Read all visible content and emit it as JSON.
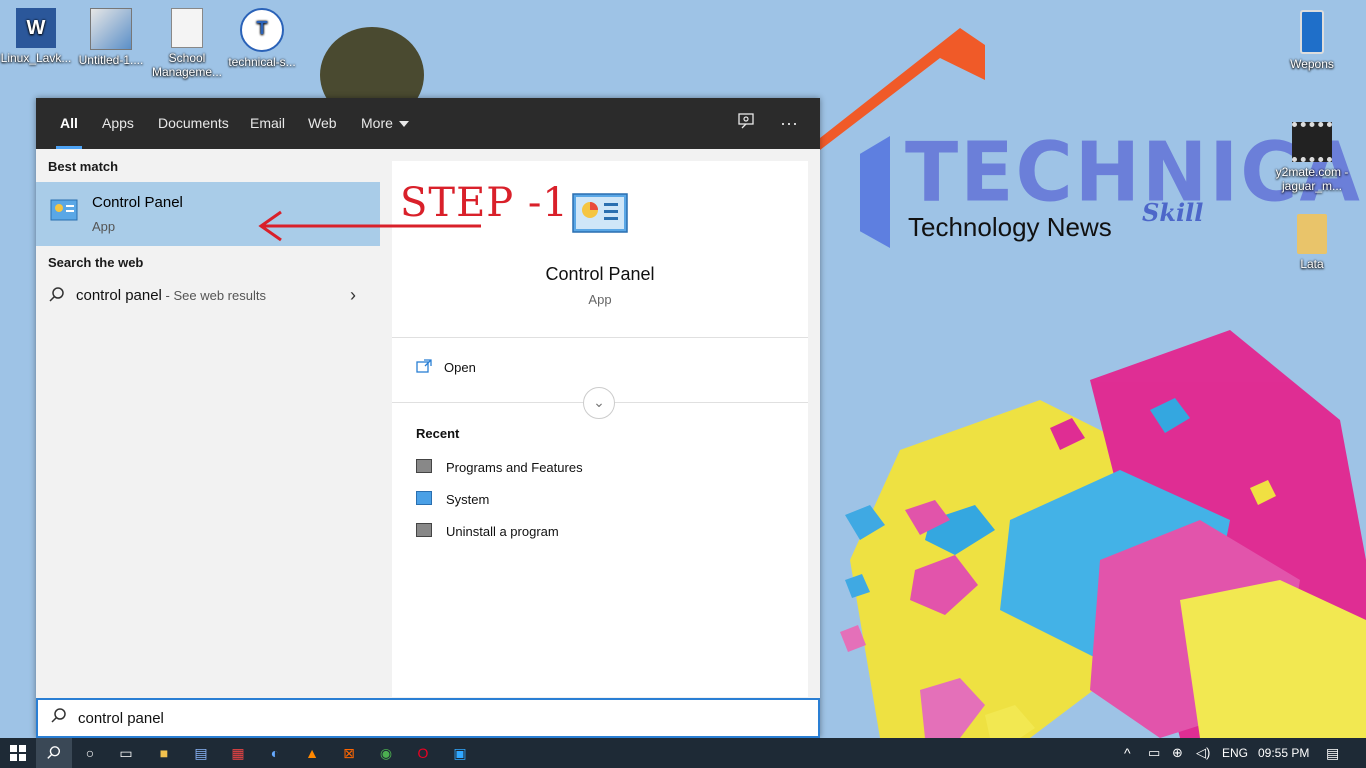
{
  "desktop": {
    "brand": {
      "title": "TECHNICAL",
      "skill": "Skill",
      "news": "Technology News"
    },
    "icons_left": [
      {
        "label": "Linux_Lavk...",
        "icon": "word-doc-icon"
      },
      {
        "label": "Untitled-1....",
        "icon": "image-icon"
      },
      {
        "label": "School Manageme...",
        "icon": "document-icon"
      },
      {
        "label": "technical-s...",
        "icon": "logo-icon"
      }
    ],
    "icons_right": [
      {
        "label": "Wepons",
        "icon": "phone-shortcut-icon"
      },
      {
        "label": "y2mate.com - jaguar_m...",
        "icon": "video-file-icon"
      },
      {
        "label": "Lata",
        "icon": "folder-icon"
      }
    ]
  },
  "search_panel": {
    "tabs": [
      "All",
      "Apps",
      "Documents",
      "Email",
      "Web",
      "More"
    ],
    "active_tab": "All",
    "best_match_heading": "Best match",
    "best_match": {
      "name": "Control Panel",
      "kind": "App"
    },
    "web_heading": "Search the web",
    "web_result": {
      "query": "control panel",
      "suffix": " - See web results"
    },
    "preview": {
      "name": "Control Panel",
      "kind": "App",
      "open_label": "Open",
      "recent_heading": "Recent",
      "recent": [
        "Programs and Features",
        "System",
        "Uninstall a program"
      ]
    },
    "search_value": "control panel"
  },
  "annotation": {
    "text": "STEP -1",
    "color": "#d9202a"
  },
  "tray": {
    "language": "ENG",
    "time": "09:55 PM"
  },
  "colors": {
    "accent": "#4da3f5",
    "selection": "#a9cce8",
    "taskbar": "#1e2a36"
  }
}
